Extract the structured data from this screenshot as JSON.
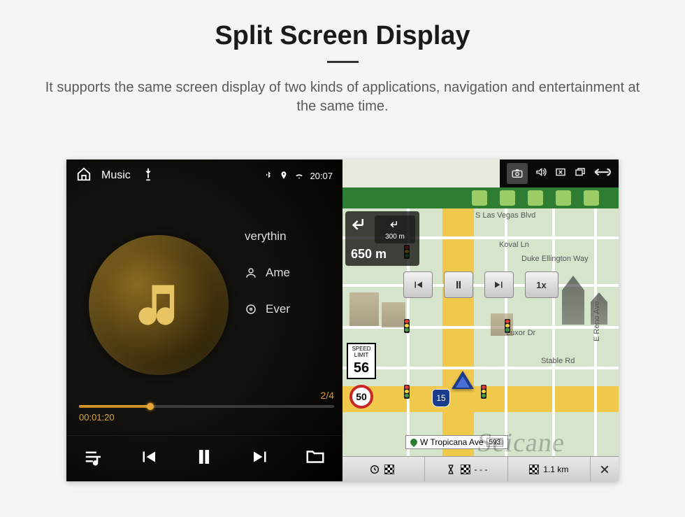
{
  "page": {
    "title": "Split Screen Display",
    "subtitle": "It supports the same screen display of two kinds of applications, navigation and entertainment at the same time."
  },
  "status_bar": {
    "time": "20:07"
  },
  "music": {
    "app_label": "Music",
    "source": "USB",
    "track_title": "verythin",
    "artist": "Ame",
    "album": "Ever",
    "elapsed": "00:01:20",
    "track_index": "2/4",
    "progress_pct": 28
  },
  "nav": {
    "download_arrows": 5,
    "turn": {
      "primary_distance": "650 m",
      "secondary_distance": "300 m"
    },
    "playback_speed": "1x",
    "speed_limit": {
      "label_top": "SPEED",
      "label_mid": "LIMIT",
      "value": "56"
    },
    "current_speed": "50",
    "interstate": "15",
    "streets": {
      "s_las_vegas": "S Las Vegas Blvd",
      "koval": "Koval Ln",
      "duke": "Duke Ellington Way",
      "luxor": "Luxor Dr",
      "stable": "Stable Rd",
      "reno": "E Reno Ave",
      "tropicana": "W Tropicana Ave"
    },
    "destination_exit": "593",
    "bottom": {
      "eta_time": "",
      "eta_countdown": "- - -",
      "remaining_distance": "1.1 km"
    }
  },
  "watermark": "Seicane"
}
